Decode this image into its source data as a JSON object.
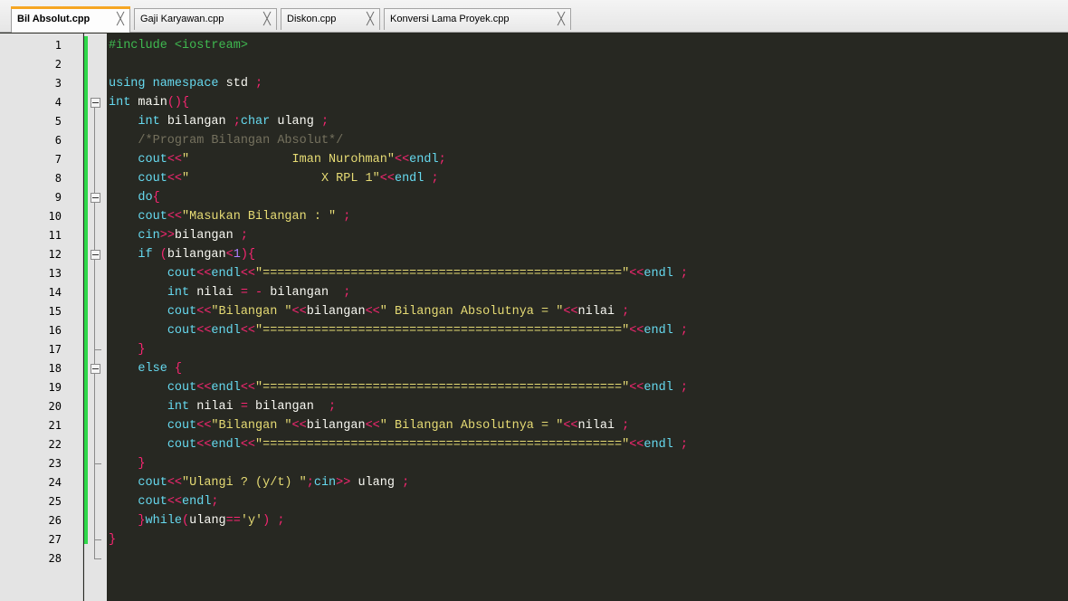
{
  "tabs": [
    {
      "label": "Bil Absolut.cpp",
      "active": true
    },
    {
      "label": "Gaji Karyawan.cpp",
      "active": false
    },
    {
      "label": "Diskon.cpp",
      "active": false
    },
    {
      "label": "Konversi Lama Proyek.cpp",
      "active": false
    }
  ],
  "close_glyph": "╳",
  "line_numbers": [
    "1",
    "2",
    "3",
    "4",
    "5",
    "6",
    "7",
    "8",
    "9",
    "10",
    "11",
    "12",
    "13",
    "14",
    "15",
    "16",
    "17",
    "18",
    "19",
    "20",
    "21",
    "22",
    "23",
    "24",
    "25",
    "26",
    "27",
    "28"
  ],
  "code_lines": [
    [
      [
        "pp",
        "#include <iostream>"
      ]
    ],
    [],
    [
      [
        "kw",
        "using namespace "
      ],
      [
        "id",
        "std "
      ],
      [
        "op",
        ";"
      ]
    ],
    [
      [
        "kw",
        "int "
      ],
      [
        "id",
        "main"
      ],
      [
        "op",
        "(){"
      ]
    ],
    [
      [
        "id",
        "    "
      ],
      [
        "kw",
        "int "
      ],
      [
        "id",
        "bilangan "
      ],
      [
        "op",
        ";"
      ],
      [
        "kw",
        "char "
      ],
      [
        "id",
        "ulang "
      ],
      [
        "op",
        ";"
      ]
    ],
    [
      [
        "cm",
        "    /*Program Bilangan Absolut*/"
      ]
    ],
    [
      [
        "id",
        "    "
      ],
      [
        "kw",
        "cout"
      ],
      [
        "op",
        "<<"
      ],
      [
        "str",
        "\"              Iman Nurohman\""
      ],
      [
        "op",
        "<<"
      ],
      [
        "kw",
        "endl"
      ],
      [
        "op",
        ";"
      ]
    ],
    [
      [
        "id",
        "    "
      ],
      [
        "kw",
        "cout"
      ],
      [
        "op",
        "<<"
      ],
      [
        "str",
        "\"                  X RPL 1\""
      ],
      [
        "op",
        "<<"
      ],
      [
        "kw",
        "endl "
      ],
      [
        "op",
        ";"
      ]
    ],
    [
      [
        "id",
        "    "
      ],
      [
        "kw",
        "do"
      ],
      [
        "op",
        "{"
      ]
    ],
    [
      [
        "id",
        "    "
      ],
      [
        "kw",
        "cout"
      ],
      [
        "op",
        "<<"
      ],
      [
        "str",
        "\"Masukan Bilangan : \" "
      ],
      [
        "op",
        ";"
      ]
    ],
    [
      [
        "id",
        "    "
      ],
      [
        "kw",
        "cin"
      ],
      [
        "op",
        ">>"
      ],
      [
        "id",
        "bilangan "
      ],
      [
        "op",
        ";"
      ]
    ],
    [
      [
        "id",
        "    "
      ],
      [
        "kw",
        "if "
      ],
      [
        "op",
        "("
      ],
      [
        "id",
        "bilangan"
      ],
      [
        "op",
        "<"
      ],
      [
        "num",
        "1"
      ],
      [
        "op",
        "){"
      ]
    ],
    [
      [
        "id",
        "        "
      ],
      [
        "kw",
        "cout"
      ],
      [
        "op",
        "<<"
      ],
      [
        "kw",
        "endl"
      ],
      [
        "op",
        "<<"
      ],
      [
        "str",
        "\"=================================================\""
      ],
      [
        "op",
        "<<"
      ],
      [
        "kw",
        "endl "
      ],
      [
        "op",
        ";"
      ]
    ],
    [
      [
        "id",
        "        "
      ],
      [
        "kw",
        "int "
      ],
      [
        "id",
        "nilai "
      ],
      [
        "op",
        "= - "
      ],
      [
        "id",
        "bilangan  "
      ],
      [
        "op",
        ";"
      ]
    ],
    [
      [
        "id",
        "        "
      ],
      [
        "kw",
        "cout"
      ],
      [
        "op",
        "<<"
      ],
      [
        "str",
        "\"Bilangan \""
      ],
      [
        "op",
        "<<"
      ],
      [
        "id",
        "bilangan"
      ],
      [
        "op",
        "<<"
      ],
      [
        "str",
        "\" Bilangan Absolutnya = \""
      ],
      [
        "op",
        "<<"
      ],
      [
        "id",
        "nilai "
      ],
      [
        "op",
        ";"
      ]
    ],
    [
      [
        "id",
        "        "
      ],
      [
        "kw",
        "cout"
      ],
      [
        "op",
        "<<"
      ],
      [
        "kw",
        "endl"
      ],
      [
        "op",
        "<<"
      ],
      [
        "str",
        "\"=================================================\""
      ],
      [
        "op",
        "<<"
      ],
      [
        "kw",
        "endl "
      ],
      [
        "op",
        ";"
      ]
    ],
    [
      [
        "id",
        "    "
      ],
      [
        "op",
        "}"
      ]
    ],
    [
      [
        "id",
        "    "
      ],
      [
        "kw",
        "else "
      ],
      [
        "op",
        "{"
      ]
    ],
    [
      [
        "id",
        "        "
      ],
      [
        "kw",
        "cout"
      ],
      [
        "op",
        "<<"
      ],
      [
        "kw",
        "endl"
      ],
      [
        "op",
        "<<"
      ],
      [
        "str",
        "\"=================================================\""
      ],
      [
        "op",
        "<<"
      ],
      [
        "kw",
        "endl "
      ],
      [
        "op",
        ";"
      ]
    ],
    [
      [
        "id",
        "        "
      ],
      [
        "kw",
        "int "
      ],
      [
        "id",
        "nilai "
      ],
      [
        "op",
        "= "
      ],
      [
        "id",
        "bilangan  "
      ],
      [
        "op",
        ";"
      ]
    ],
    [
      [
        "id",
        "        "
      ],
      [
        "kw",
        "cout"
      ],
      [
        "op",
        "<<"
      ],
      [
        "str",
        "\"Bilangan \""
      ],
      [
        "op",
        "<<"
      ],
      [
        "id",
        "bilangan"
      ],
      [
        "op",
        "<<"
      ],
      [
        "str",
        "\" Bilangan Absolutnya = \""
      ],
      [
        "op",
        "<<"
      ],
      [
        "id",
        "nilai "
      ],
      [
        "op",
        ";"
      ]
    ],
    [
      [
        "id",
        "        "
      ],
      [
        "kw",
        "cout"
      ],
      [
        "op",
        "<<"
      ],
      [
        "kw",
        "endl"
      ],
      [
        "op",
        "<<"
      ],
      [
        "str",
        "\"=================================================\""
      ],
      [
        "op",
        "<<"
      ],
      [
        "kw",
        "endl "
      ],
      [
        "op",
        ";"
      ]
    ],
    [
      [
        "id",
        "    "
      ],
      [
        "op",
        "}"
      ]
    ],
    [
      [
        "id",
        "    "
      ],
      [
        "kw",
        "cout"
      ],
      [
        "op",
        "<<"
      ],
      [
        "str",
        "\"Ulangi ? (y/t) \""
      ],
      [
        "op",
        ";"
      ],
      [
        "kw",
        "cin"
      ],
      [
        "op",
        ">> "
      ],
      [
        "id",
        "ulang "
      ],
      [
        "op",
        ";"
      ]
    ],
    [
      [
        "id",
        "    "
      ],
      [
        "kw",
        "cout"
      ],
      [
        "op",
        "<<"
      ],
      [
        "kw",
        "endl"
      ],
      [
        "op",
        ";"
      ]
    ],
    [
      [
        "id",
        "    "
      ],
      [
        "op",
        "}"
      ],
      [
        "kw",
        "while"
      ],
      [
        "op",
        "("
      ],
      [
        "id",
        "ulang"
      ],
      [
        "op",
        "=="
      ],
      [
        "str",
        "'y'"
      ],
      [
        "op",
        ") ;"
      ]
    ],
    [
      [
        "op",
        "}"
      ]
    ],
    []
  ],
  "colors": {
    "editor_background": "#272822",
    "gutter_background": "#e4e4e4",
    "change_marker": "#2fd84a",
    "active_tab_accent": "#f6a623",
    "keyword": "#66d9ef",
    "operator": "#f92672",
    "string": "#e6db74",
    "number": "#ae81ff",
    "preprocessor": "#3fb950",
    "comment": "#75715e"
  }
}
